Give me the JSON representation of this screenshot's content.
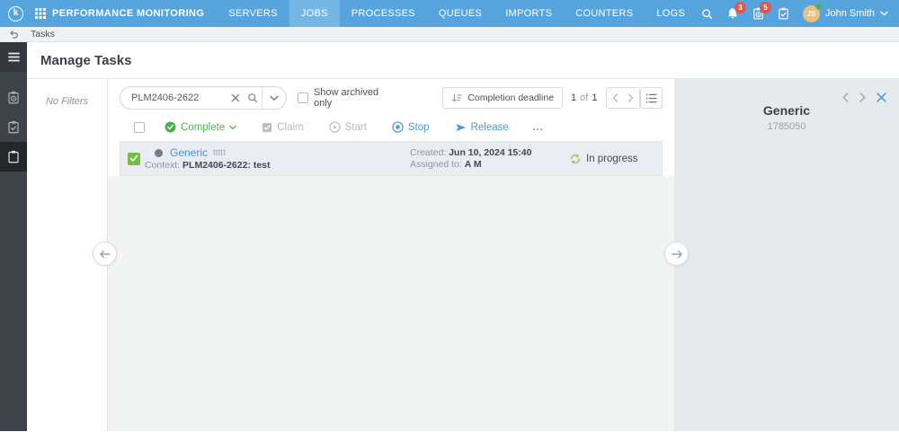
{
  "topbar": {
    "logo_letter": "k",
    "app_title": "PERFORMANCE MONITORING",
    "nav": [
      {
        "label": "SERVERS"
      },
      {
        "label": "JOBS",
        "active": true
      },
      {
        "label": "PROCESSES"
      },
      {
        "label": "QUEUES"
      },
      {
        "label": "IMPORTS"
      },
      {
        "label": "COUNTERS"
      },
      {
        "label": "LOGS"
      }
    ],
    "badges": {
      "notifications": "3",
      "scheduled_tasks": "5"
    },
    "user": {
      "initials": "JS",
      "name": "John Smith"
    }
  },
  "breadcrumb": {
    "label": "Tasks"
  },
  "page": {
    "title": "Manage Tasks"
  },
  "filters": {
    "empty_label": "No Filters"
  },
  "toolbar": {
    "search_value": "PLM2406-2622",
    "archived_label": "Show archived only",
    "sort_label": "Completion deadline",
    "pagination": {
      "current": "1",
      "of_label": "of",
      "total": "1"
    }
  },
  "actions": {
    "complete": "Complete",
    "claim": "Claim",
    "start": "Start",
    "stop": "Stop",
    "release": "Release",
    "more": "…"
  },
  "task": {
    "title": "Generic",
    "title_suffix": "ttttt",
    "context_label": "Context:",
    "context_value": "PLM2406-2622: test",
    "created_label": "Created:",
    "created_value": "Jun 10, 2024 15:40",
    "assigned_label": "Assigned to:",
    "assigned_value": "A M",
    "status": "In progress"
  },
  "detail_panel": {
    "title": "Generic",
    "id": "1785050"
  },
  "colors": {
    "topbar_blue": "#55a4dd",
    "active_tab_blue": "#74b6e4",
    "badge_red": "#e2574b",
    "link_blue": "#4a90d9",
    "action_green": "#52ae57",
    "action_blue": "#4b99de",
    "status_green": "#86c150",
    "checked_green": "#72bf44",
    "sidebar_dark": "#3e434a",
    "panel_gray": "#e7eaec"
  }
}
